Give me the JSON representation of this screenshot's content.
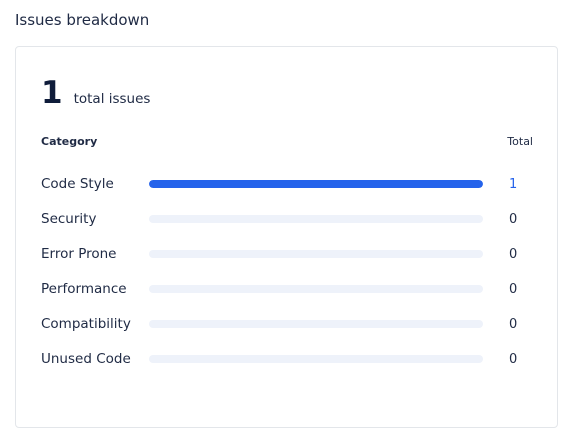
{
  "section_title": "Issues breakdown",
  "summary": {
    "total_count": "1",
    "total_label": "total issues"
  },
  "table": {
    "category_header": "Category",
    "total_header": "Total"
  },
  "categories": [
    {
      "label": "Code Style",
      "count": "1",
      "share": 1.0
    },
    {
      "label": "Security",
      "count": "0",
      "share": 0
    },
    {
      "label": "Error Prone",
      "count": "0",
      "share": 0
    },
    {
      "label": "Performance",
      "count": "0",
      "share": 0
    },
    {
      "label": "Compatibility",
      "count": "0",
      "share": 0
    },
    {
      "label": "Unused Code",
      "count": "0",
      "share": 0
    }
  ],
  "colors": {
    "accent": "#2563eb",
    "track": "#eef2fa"
  }
}
